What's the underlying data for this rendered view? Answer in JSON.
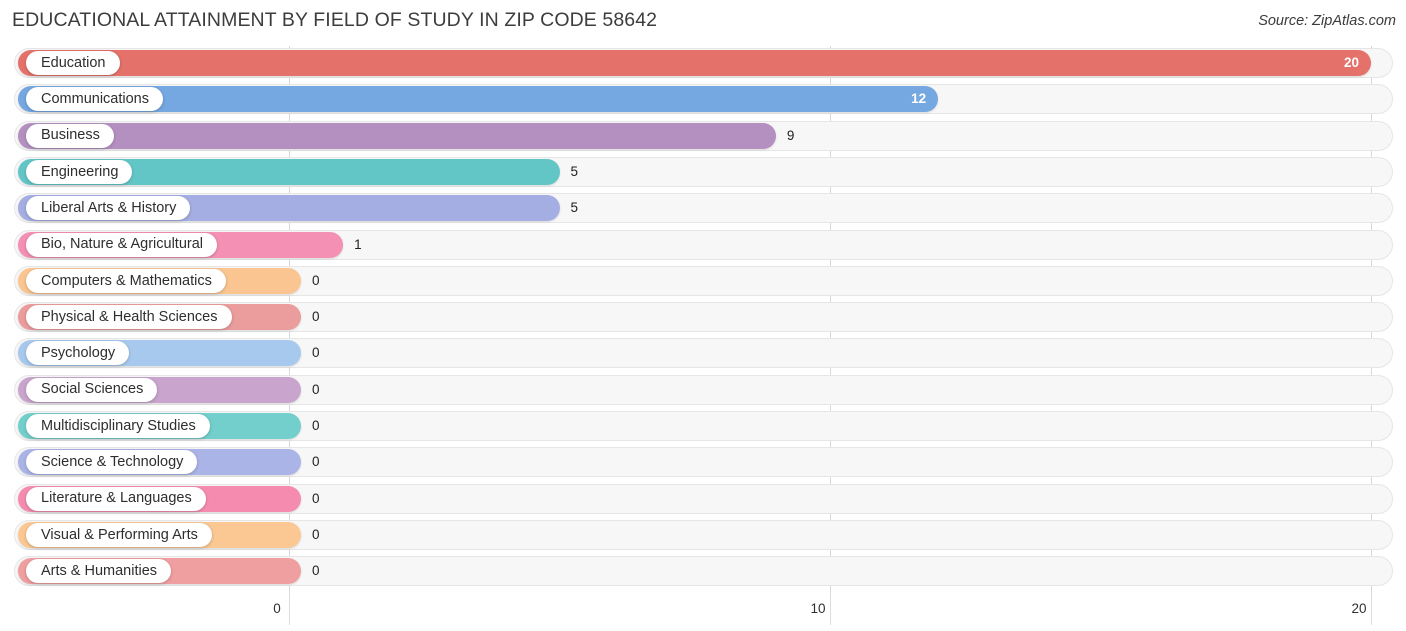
{
  "header": {
    "title": "EDUCATIONAL ATTAINMENT BY FIELD OF STUDY IN ZIP CODE 58642",
    "source": "Source: ZipAtlas.com"
  },
  "chart_data": {
    "type": "bar",
    "orientation": "horizontal",
    "title": "EDUCATIONAL ATTAINMENT BY FIELD OF STUDY IN ZIP CODE 58642",
    "xlabel": "",
    "ylabel": "",
    "xlim": [
      0,
      20
    ],
    "grid": true,
    "legend": "none",
    "xticks": [
      "0",
      "10",
      "20"
    ],
    "xtick_values": [
      0,
      10,
      20
    ],
    "categories": [
      "Education",
      "Communications",
      "Business",
      "Engineering",
      "Liberal Arts & History",
      "Bio, Nature & Agricultural",
      "Computers & Mathematics",
      "Physical & Health Sciences",
      "Psychology",
      "Social Sciences",
      "Multidisciplinary Studies",
      "Science & Technology",
      "Literature & Languages",
      "Visual & Performing Arts",
      "Arts & Humanities"
    ],
    "values": [
      20,
      12,
      9,
      5,
      5,
      1,
      0,
      0,
      0,
      0,
      0,
      0,
      0,
      0,
      0
    ],
    "value_labels": [
      "20",
      "12",
      "9",
      "5",
      "5",
      "1",
      "0",
      "0",
      "0",
      "0",
      "0",
      "0",
      "0",
      "0",
      "0"
    ],
    "colors": [
      "#e4726a",
      "#75a7e0",
      "#b490c0",
      "#63c6c6",
      "#a5aee2",
      "#f490b4",
      "#fac591",
      "#eb9c9c",
      "#a7c9ee",
      "#c9a4cd",
      "#72cfcb",
      "#aab4e6",
      "#f58cb0",
      "#fbc793",
      "#ef9f9f"
    ]
  },
  "rows": [
    {
      "label": "Education",
      "value": 20,
      "value_label": "20",
      "color": "#e4726a",
      "inside": true
    },
    {
      "label": "Communications",
      "value": 12,
      "value_label": "12",
      "color": "#75a7e0",
      "inside": true
    },
    {
      "label": "Business",
      "value": 9,
      "value_label": "9",
      "color": "#b490c0",
      "inside": false
    },
    {
      "label": "Engineering",
      "value": 5,
      "value_label": "5",
      "color": "#63c6c6",
      "inside": false
    },
    {
      "label": "Liberal Arts & History",
      "value": 5,
      "value_label": "5",
      "color": "#a5aee2",
      "inside": false
    },
    {
      "label": "Bio, Nature & Agricultural",
      "value": 1,
      "value_label": "1",
      "color": "#f490b4",
      "inside": false
    },
    {
      "label": "Computers & Mathematics",
      "value": 0,
      "value_label": "0",
      "color": "#fac591",
      "inside": false
    },
    {
      "label": "Physical & Health Sciences",
      "value": 0,
      "value_label": "0",
      "color": "#eb9c9c",
      "inside": false
    },
    {
      "label": "Psychology",
      "value": 0,
      "value_label": "0",
      "color": "#a7c9ee",
      "inside": false
    },
    {
      "label": "Social Sciences",
      "value": 0,
      "value_label": "0",
      "color": "#c9a4cd",
      "inside": false
    },
    {
      "label": "Multidisciplinary Studies",
      "value": 0,
      "value_label": "0",
      "color": "#72cfcb",
      "inside": false
    },
    {
      "label": "Science & Technology",
      "value": 0,
      "value_label": "0",
      "color": "#aab4e6",
      "inside": false
    },
    {
      "label": "Literature & Languages",
      "value": 0,
      "value_label": "0",
      "color": "#f58cb0",
      "inside": false
    },
    {
      "label": "Visual & Performing Arts",
      "value": 0,
      "value_label": "0",
      "color": "#fbc793",
      "inside": false
    },
    {
      "label": "Arts & Humanities",
      "value": 0,
      "value_label": "0",
      "color": "#ef9f9f",
      "inside": false
    }
  ],
  "axis": {
    "ticks": [
      {
        "label": "0",
        "value": 0
      },
      {
        "label": "10",
        "value": 10
      },
      {
        "label": "20",
        "value": 20
      }
    ]
  }
}
